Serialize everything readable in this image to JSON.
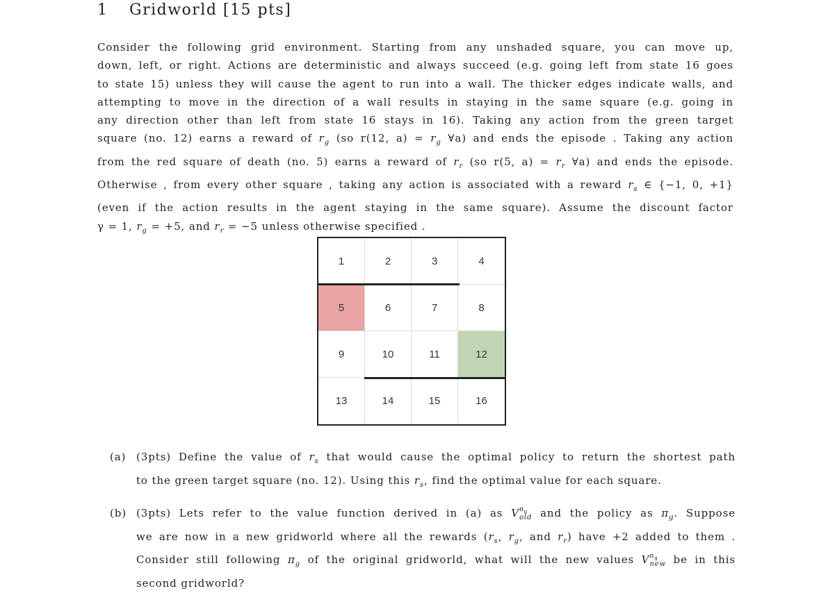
{
  "heading": {
    "number": "1",
    "title": "Gridworld [15 pts]"
  },
  "intro_lines": [
    "Consider the following grid environment. Starting from any unshaded square, you can move up,",
    "down, left, or right. Actions are deterministic and always succeed (e.g. going left from state 16 goes",
    "to state 15) unless they will cause the agent to run into a wall. The thicker edges indicate walls, and",
    "attempting to move in the direction of a wall results in staying in the same square (e.g. going in",
    "any direction other than left from state 16 stays in 16). Taking any action from the green target",
    "square (no. 12) earns a reward of r_g (so r(12, a) = r_g ∀a) and ends the episode . Taking any action",
    "from the red square of death (no. 5) earns a reward of r_r (so r(5, a) = r_r ∀a) and ends the episode.",
    "Otherwise , from every other square , taking any action is associated with a reward r_s ∈ {−1, 0, +1}",
    "(even if the action results in the agent staying in the same square). Assume the discount factor",
    "γ = 1, r_g = +5, and r_r = −5 unless otherwise specified ."
  ],
  "grid": {
    "cells": [
      "1",
      "2",
      "3",
      "4",
      "5",
      "6",
      "7",
      "8",
      "9",
      "10",
      "11",
      "12",
      "13",
      "14",
      "15",
      "16"
    ],
    "red_cell": "5",
    "green_cell": "12",
    "colors": {
      "red": "#e8a3a3",
      "green": "#c1d5b6"
    }
  },
  "parts": [
    {
      "label": "(a)",
      "lines": [
        "(3pts) Define the value of r_s that would cause the optimal policy to return the shortest path",
        "to the green target square (no. 12). Using this r_s, find the optimal value for each square."
      ]
    },
    {
      "label": "(b)",
      "lines": [
        "(3pts) Lets refer to the value function derived in (a) as V_old^πg and the policy as π_g. Suppose",
        "we are now in a new gridworld where all the rewards (r_s, r_g, and r_r) have +2 added to them .",
        "Consider still following π_g of the original gridworld, what will the new values V_new^πg be in this",
        "second gridworld?"
      ]
    }
  ]
}
